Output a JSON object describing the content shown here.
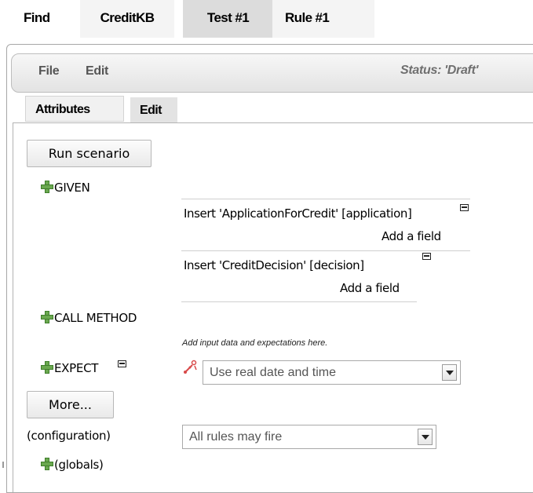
{
  "top_tabs": [
    {
      "label": "Find"
    },
    {
      "label": "CreditKB"
    },
    {
      "label": "Test #1"
    },
    {
      "label": "Rule #1"
    }
  ],
  "menubar": {
    "file": "File",
    "edit": "Edit",
    "status": "Status: 'Draft'"
  },
  "sub_tabs": [
    {
      "label": "Attributes"
    },
    {
      "label": "Edit"
    }
  ],
  "scenario": {
    "run_button": "Run scenario",
    "given_label": "GIVEN",
    "facts": [
      {
        "text": "Insert 'ApplicationForCredit' [application]",
        "add_field": "Add a field"
      },
      {
        "text": "Insert 'CreditDecision' [decision]",
        "add_field": "Add a field"
      }
    ],
    "call_method_label": "CALL METHOD",
    "hint": "Add input data and expectations here.",
    "expect_label": "EXPECT",
    "date_select": "Use real date and time",
    "more_button": "More...",
    "configuration_label": "(configuration)",
    "rules_select": "All rules may fire",
    "globals_label": "(globals)"
  },
  "colors": {
    "plus_icon": "#6aa84f",
    "active_tab": "#dcdcdc",
    "wand_icon": "#d84a4a"
  }
}
